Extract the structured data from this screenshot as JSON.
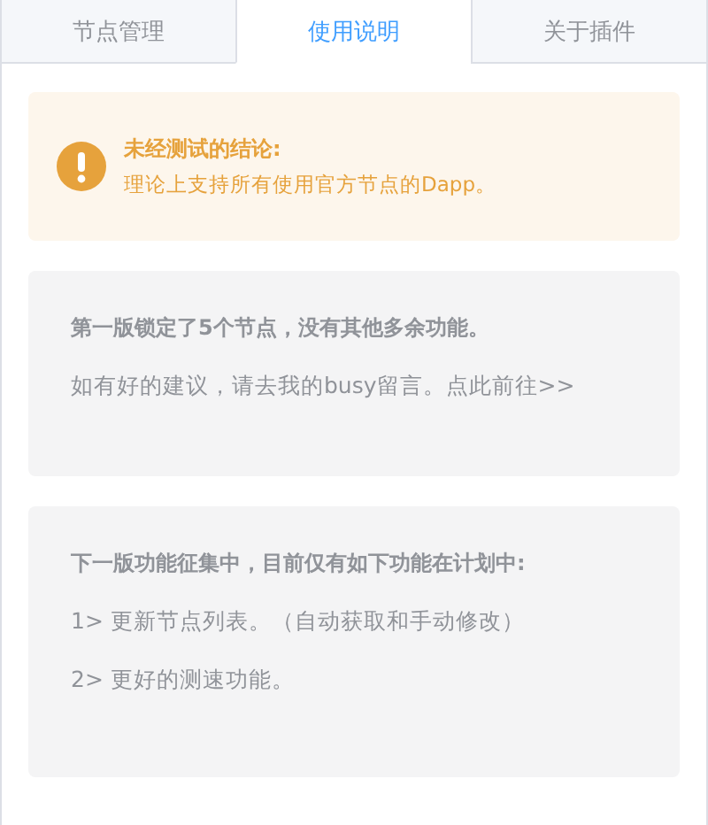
{
  "tabs": [
    {
      "label": "节点管理",
      "selected": false
    },
    {
      "label": "使用说明",
      "selected": true
    },
    {
      "label": "关于插件",
      "selected": false
    }
  ],
  "alert": {
    "title": "未经测试的结论:",
    "message": "理论上支持所有使用官方节点的Dapp。"
  },
  "cards": [
    {
      "lines": [
        {
          "kind": "heading",
          "text": "第一版锁定了5个节点，没有其他多余功能。"
        },
        {
          "kind": "text",
          "text": "如有好的建议，请去我的busy留言。",
          "link": "点此前往>>"
        }
      ]
    },
    {
      "lines": [
        {
          "kind": "heading",
          "text": "下一版功能征集中，目前仅有如下功能在计划中:"
        },
        {
          "kind": "text",
          "text": "1> 更新节点列表。（自动获取和手动修改）"
        },
        {
          "kind": "text",
          "text": "2> 更好的测速功能。"
        }
      ]
    }
  ]
}
